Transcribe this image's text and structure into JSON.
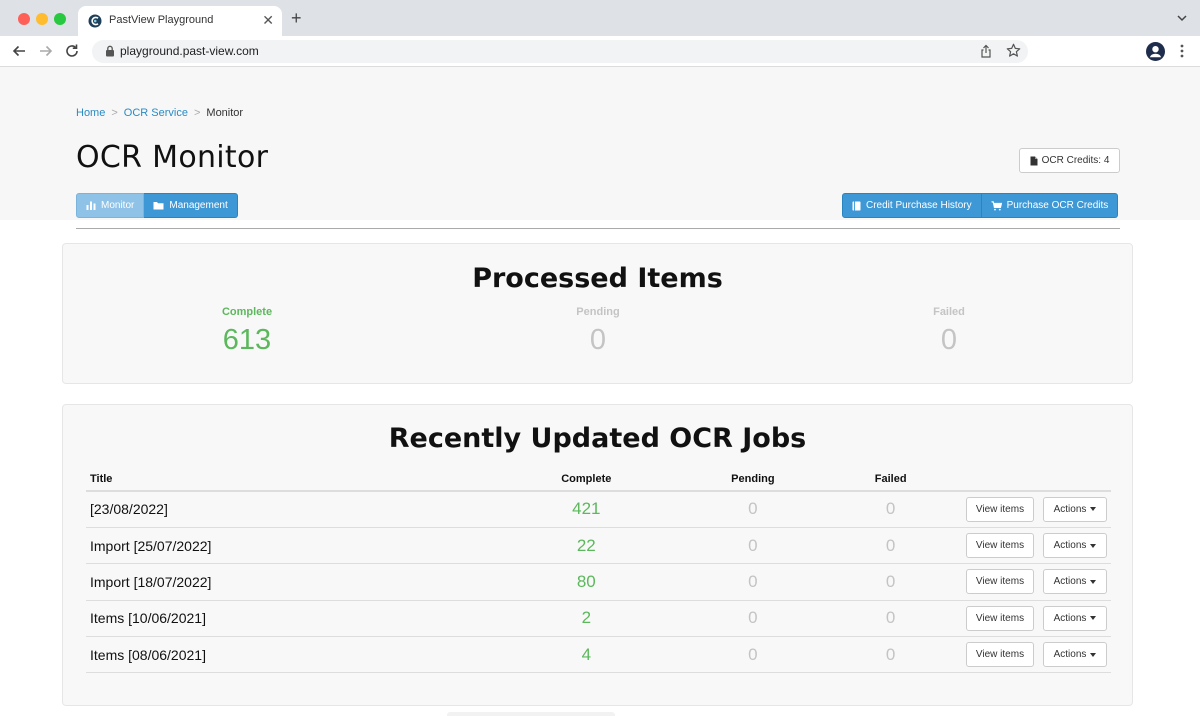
{
  "browser": {
    "tab_title": "PastView Playground",
    "new_tab_label": "+",
    "close_label": "✕",
    "url": "playground.past-view.com"
  },
  "breadcrumb": {
    "home": "Home",
    "ocr_service": "OCR Service",
    "current": "Monitor",
    "separator": ">"
  },
  "page_title": "OCR Monitor",
  "credits_badge": "OCR Credits: 4",
  "tabs": {
    "monitor": "Monitor",
    "management": "Management"
  },
  "actions_bar": {
    "history": "Credit Purchase History",
    "purchase": "Purchase OCR Credits"
  },
  "processed": {
    "title": "Processed Items",
    "complete_label": "Complete",
    "complete_value": "613",
    "pending_label": "Pending",
    "pending_value": "0",
    "failed_label": "Failed",
    "failed_value": "0"
  },
  "jobs": {
    "title": "Recently Updated OCR Jobs",
    "headers": {
      "title": "Title",
      "complete": "Complete",
      "pending": "Pending",
      "failed": "Failed"
    },
    "view_label": "View items",
    "actions_label": "Actions",
    "rows": [
      {
        "title": "[23/08/2022]",
        "complete": "421",
        "pending": "0",
        "failed": "0"
      },
      {
        "title": "Import [25/07/2022]",
        "complete": "22",
        "pending": "0",
        "failed": "0"
      },
      {
        "title": "Import [18/07/2022]",
        "complete": "80",
        "pending": "0",
        "failed": "0"
      },
      {
        "title": "Items [10/06/2021]",
        "complete": "2",
        "pending": "0",
        "failed": "0"
      },
      {
        "title": "Items [08/06/2021]",
        "complete": "4",
        "pending": "0",
        "failed": "0"
      }
    ]
  },
  "colors": {
    "link": "#2a8bc4",
    "primary": "#3e98d6",
    "complete_green": "#5cb85c",
    "muted_grey": "#c4c4c4"
  }
}
